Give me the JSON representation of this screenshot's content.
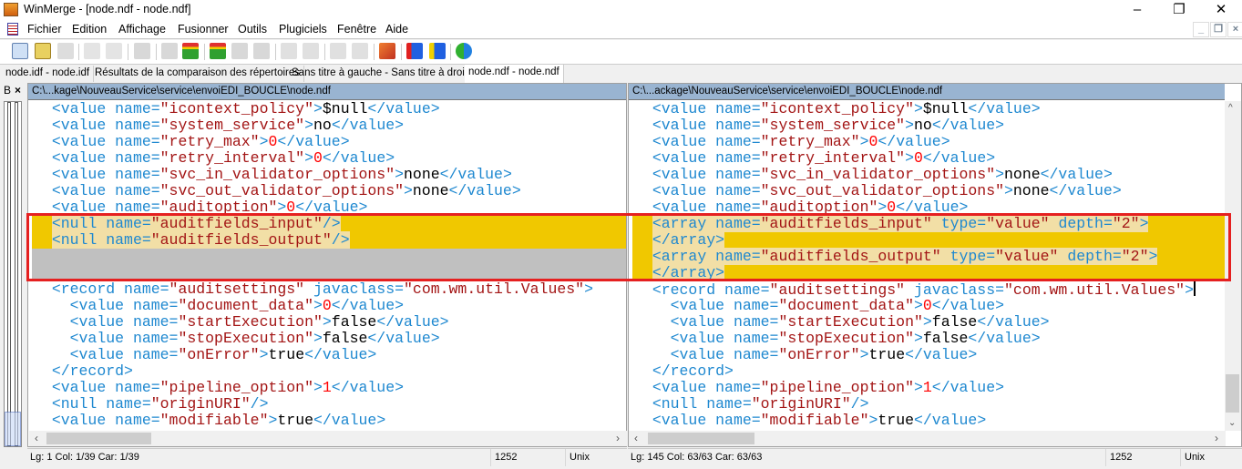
{
  "window": {
    "title": "WinMerge - [node.ndf - node.ndf]"
  },
  "menu": [
    "Fichier",
    "Edition",
    "Affichage",
    "Fusionner",
    "Outils",
    "Plugiciels",
    "Fenêtre",
    "Aide"
  ],
  "tabs": [
    "node.idf - node.idf",
    "Résultats de la comparaison des répertoires",
    "Sans titre à gauche - Sans titre à droite",
    "node.ndf - node.ndf"
  ],
  "location_pane": {
    "label": "B",
    "close": "×"
  },
  "left": {
    "path": "C:\\...kage\\NouveauService\\service\\envoiEDI_BOUCLE\\node.ndf",
    "lines": [
      {
        "s": "n",
        "t": "  <value name=\"icontext_policy\">$null</value>"
      },
      {
        "s": "n",
        "t": "  <value name=\"system_service\">no</value>"
      },
      {
        "s": "n",
        "t": "  <value name=\"retry_max\">0</value>"
      },
      {
        "s": "n",
        "t": "  <value name=\"retry_interval\">0</value>"
      },
      {
        "s": "n",
        "t": "  <value name=\"svc_in_validator_options\">none</value>"
      },
      {
        "s": "n",
        "t": "  <value name=\"svc_out_validator_options\">none</value>"
      },
      {
        "s": "n",
        "t": "  <value name=\"auditoption\">0</value>"
      },
      {
        "s": "d",
        "t": "  <null name=\"auditfields_input\"/>"
      },
      {
        "s": "d",
        "t": "  <null name=\"auditfields_output\"/>"
      },
      {
        "s": "g",
        "t": ""
      },
      {
        "s": "g",
        "t": ""
      },
      {
        "s": "n",
        "t": "  <record name=\"auditsettings\" javaclass=\"com.wm.util.Values\">"
      },
      {
        "s": "n",
        "t": "    <value name=\"document_data\">0</value>"
      },
      {
        "s": "n",
        "t": "    <value name=\"startExecution\">false</value>"
      },
      {
        "s": "n",
        "t": "    <value name=\"stopExecution\">false</value>"
      },
      {
        "s": "n",
        "t": "    <value name=\"onError\">true</value>"
      },
      {
        "s": "n",
        "t": "  </record>"
      },
      {
        "s": "n",
        "t": "  <value name=\"pipeline_option\">1</value>"
      },
      {
        "s": "n",
        "t": "  <null name=\"originURI\"/>"
      },
      {
        "s": "n",
        "t": "  <value name=\"modifiable\">true</value>"
      }
    ],
    "status": {
      "pos": "Lg: 1  Col: 1/39  Car: 1/39",
      "codepage": "1252",
      "eol": "Unix"
    }
  },
  "right": {
    "path": "C:\\...ackage\\NouveauService\\service\\envoiEDI_BOUCLE\\node.ndf",
    "lines": [
      {
        "s": "n",
        "t": "  <value name=\"icontext_policy\">$null</value>"
      },
      {
        "s": "n",
        "t": "  <value name=\"system_service\">no</value>"
      },
      {
        "s": "n",
        "t": "  <value name=\"retry_max\">0</value>"
      },
      {
        "s": "n",
        "t": "  <value name=\"retry_interval\">0</value>"
      },
      {
        "s": "n",
        "t": "  <value name=\"svc_in_validator_options\">none</value>"
      },
      {
        "s": "n",
        "t": "  <value name=\"svc_out_validator_options\">none</value>"
      },
      {
        "s": "n",
        "t": "  <value name=\"auditoption\">0</value>"
      },
      {
        "s": "d",
        "t": "  <array name=\"auditfields_input\" type=\"value\" depth=\"2\">"
      },
      {
        "s": "d",
        "t": "  </array>"
      },
      {
        "s": "d",
        "t": "  <array name=\"auditfields_output\" type=\"value\" depth=\"2\">"
      },
      {
        "s": "d",
        "t": "  </array>"
      },
      {
        "s": "n",
        "t": "  <record name=\"auditsettings\" javaclass=\"com.wm.util.Values\">"
      },
      {
        "s": "n",
        "t": "    <value name=\"document_data\">0</value>"
      },
      {
        "s": "n",
        "t": "    <value name=\"startExecution\">false</value>"
      },
      {
        "s": "n",
        "t": "    <value name=\"stopExecution\">false</value>"
      },
      {
        "s": "n",
        "t": "    <value name=\"onError\">true</value>"
      },
      {
        "s": "n",
        "t": "  </record>"
      },
      {
        "s": "n",
        "t": "  <value name=\"pipeline_option\">1</value>"
      },
      {
        "s": "n",
        "t": "  <null name=\"originURI\"/>"
      },
      {
        "s": "n",
        "t": "  <value name=\"modifiable\">true</value>"
      }
    ],
    "status": {
      "pos": "Lg: 145  Col: 63/63  Car: 63/63",
      "codepage": "1252",
      "eol": "Unix"
    }
  },
  "colors": {
    "diff": "#f0c800",
    "diff_word": "#f2dfa6",
    "gap": "#c0c0c0",
    "tag": "#1e88d0",
    "string": "#a31515",
    "number": "#ff0000",
    "highlight_box": "#e52020"
  }
}
